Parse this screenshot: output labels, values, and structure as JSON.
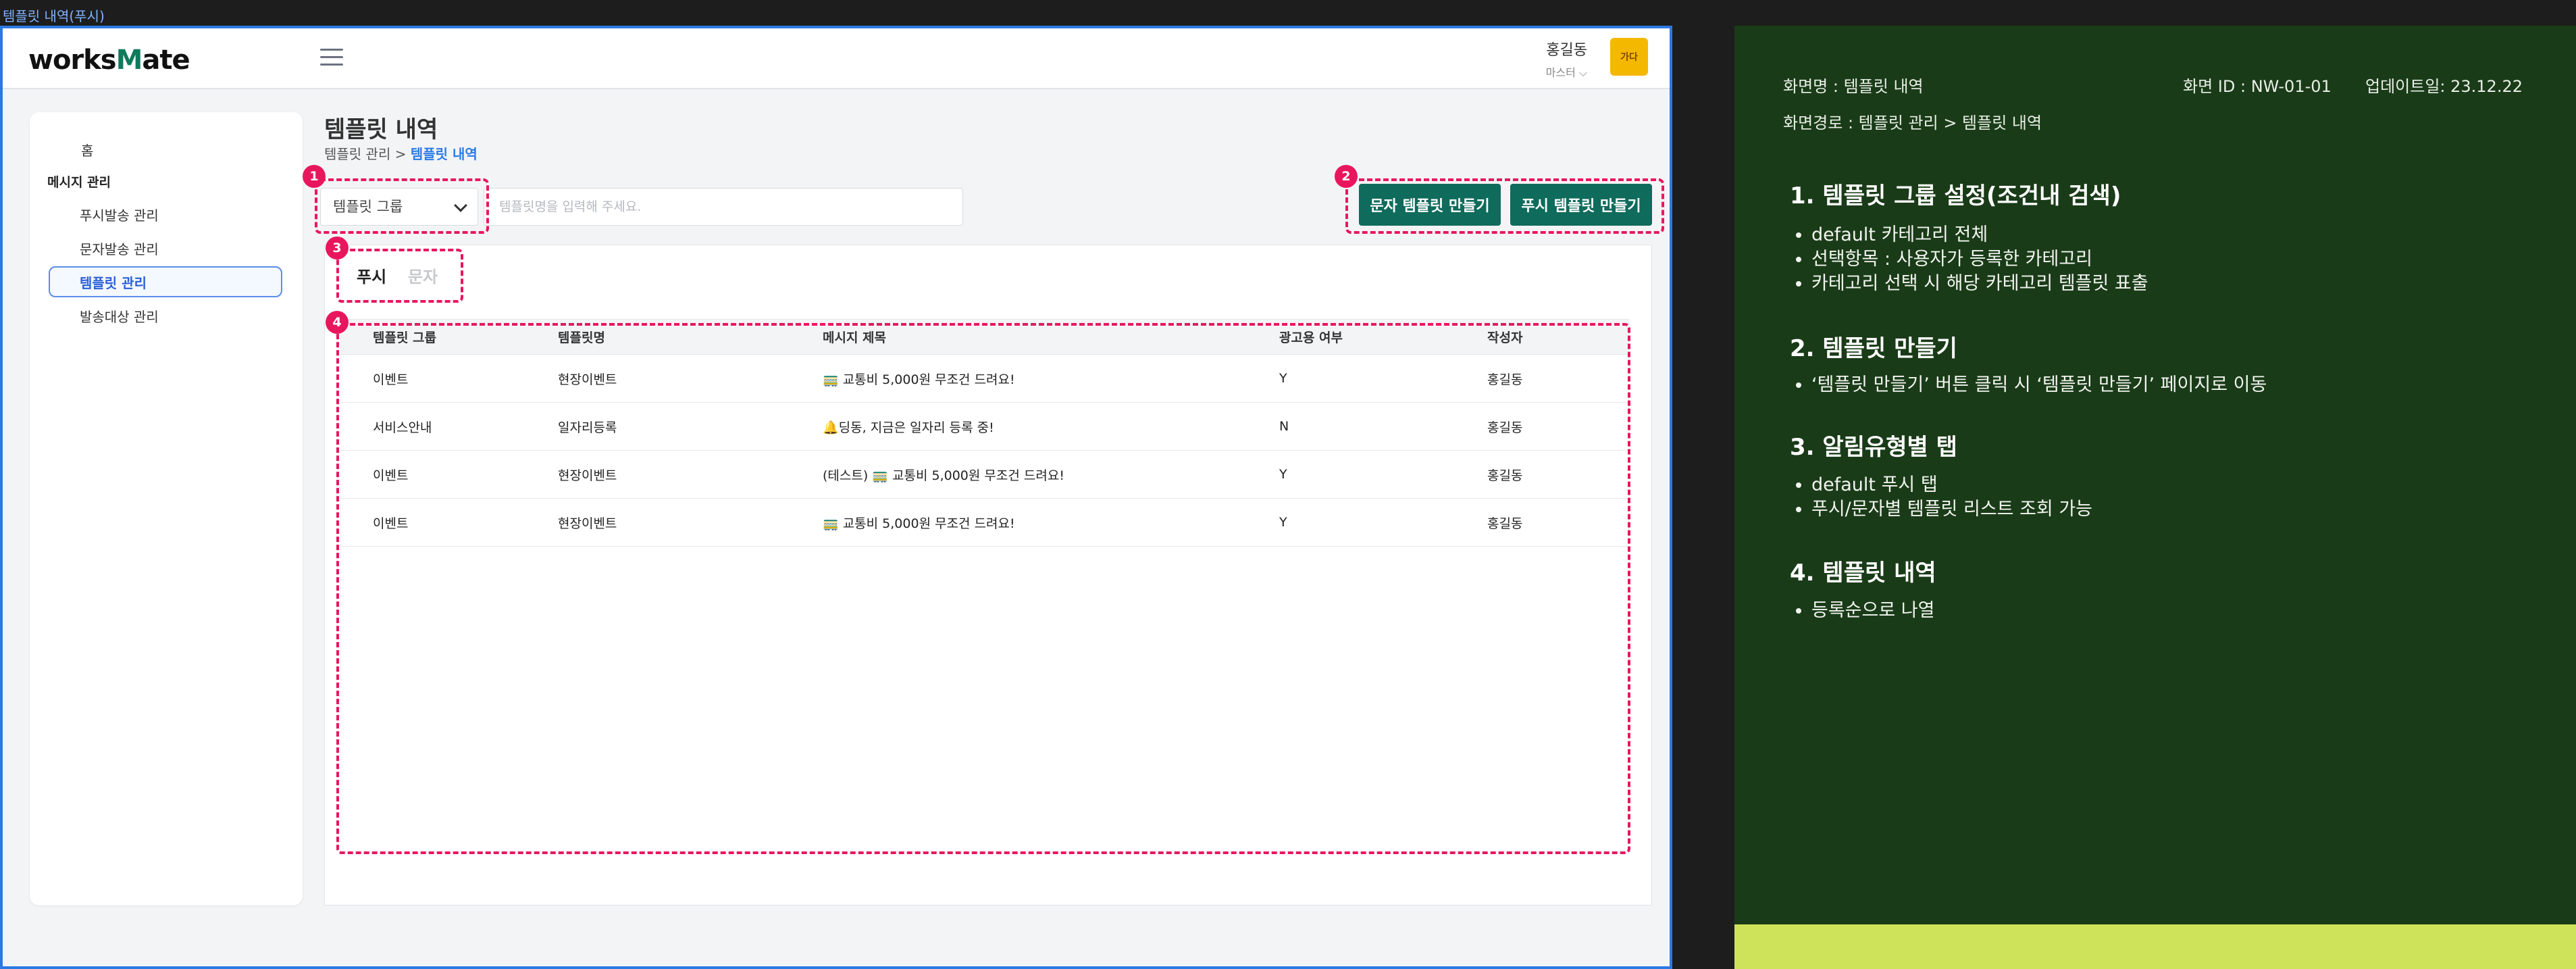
{
  "frame_label": "템플릿 내역(푸시)",
  "topbar": {
    "logo_pre": "works",
    "logo_m": "M",
    "logo_post": "ate",
    "user_name": "홍길동",
    "user_role": "마스터 ⌵",
    "user_badge": "가다"
  },
  "sidebar": {
    "home": "홈",
    "section": "메시지 관리",
    "items": [
      {
        "label": "푸시발송 관리",
        "active": false
      },
      {
        "label": "문자발송 관리",
        "active": false
      },
      {
        "label": "템플릿 관리",
        "active": true
      },
      {
        "label": "발송대상 관리",
        "active": false
      }
    ]
  },
  "main": {
    "title": "템플릿 내역",
    "breadcrumb_parent": "템플릿 관리 >",
    "breadcrumb_current": "템플릿 내역",
    "group_select": "템플릿 그룹",
    "search_placeholder": "템플릿명을 입력해 주세요.",
    "btn_sms": "문자 템플릿 만들기",
    "btn_push": "푸시 템플릿 만들기",
    "tab_push": "푸시",
    "tab_sms": "문자",
    "columns": [
      "템플릿 그룹",
      "템플릿명",
      "메시지 제목",
      "광고용 여부",
      "작성자"
    ],
    "rows": [
      [
        "이벤트",
        "현장이벤트",
        "🚃 교통비 5,000원 무조건 드려요!",
        "Y",
        "홍길동"
      ],
      [
        "서비스안내",
        "일자리등록",
        "🔔딩동, 지금은 일자리 등록 중!",
        "N",
        "홍길동"
      ],
      [
        "이벤트",
        "현장이벤트",
        "(테스트) 🚃 교통비 5,000원 무조건 드려요!",
        "Y",
        "홍길동"
      ],
      [
        "이벤트",
        "현장이벤트",
        "🚃 교통비 5,000원 무조건 드려요!",
        "Y",
        "홍길동"
      ]
    ]
  },
  "markers": [
    "1",
    "2",
    "3",
    "4"
  ],
  "panel": {
    "screen_name": "화면명 : 템플릿 내역",
    "screen_id": "화면 ID :  NW-01-01",
    "updated": "업데이트일: 23.12.22",
    "screen_path": "화면경로 : 템플릿 관리 > 템플릿 내역",
    "sections": [
      {
        "title": "1. 템플릿 그룹 설정(조건내 검색)",
        "items": [
          "default 카테고리 전체",
          "선택항목 : 사용자가 등록한 카테고리",
          "카테고리 선택 시 해당 카테고리 템플릿 표출"
        ]
      },
      {
        "title": "2. 템플릿 만들기",
        "items": [
          "‘템플릿 만들기’ 버튼 클릭 시 ‘템플릿 만들기’ 페이지로 이동"
        ]
      },
      {
        "title": "3. 알림유형별 탭",
        "items": [
          "default 푸시 탭",
          "푸시/문자별 템플릿 리스트 조회 가능"
        ]
      },
      {
        "title": "4. 템플릿 내역",
        "items": [
          "등록순으로 나열"
        ]
      }
    ]
  }
}
